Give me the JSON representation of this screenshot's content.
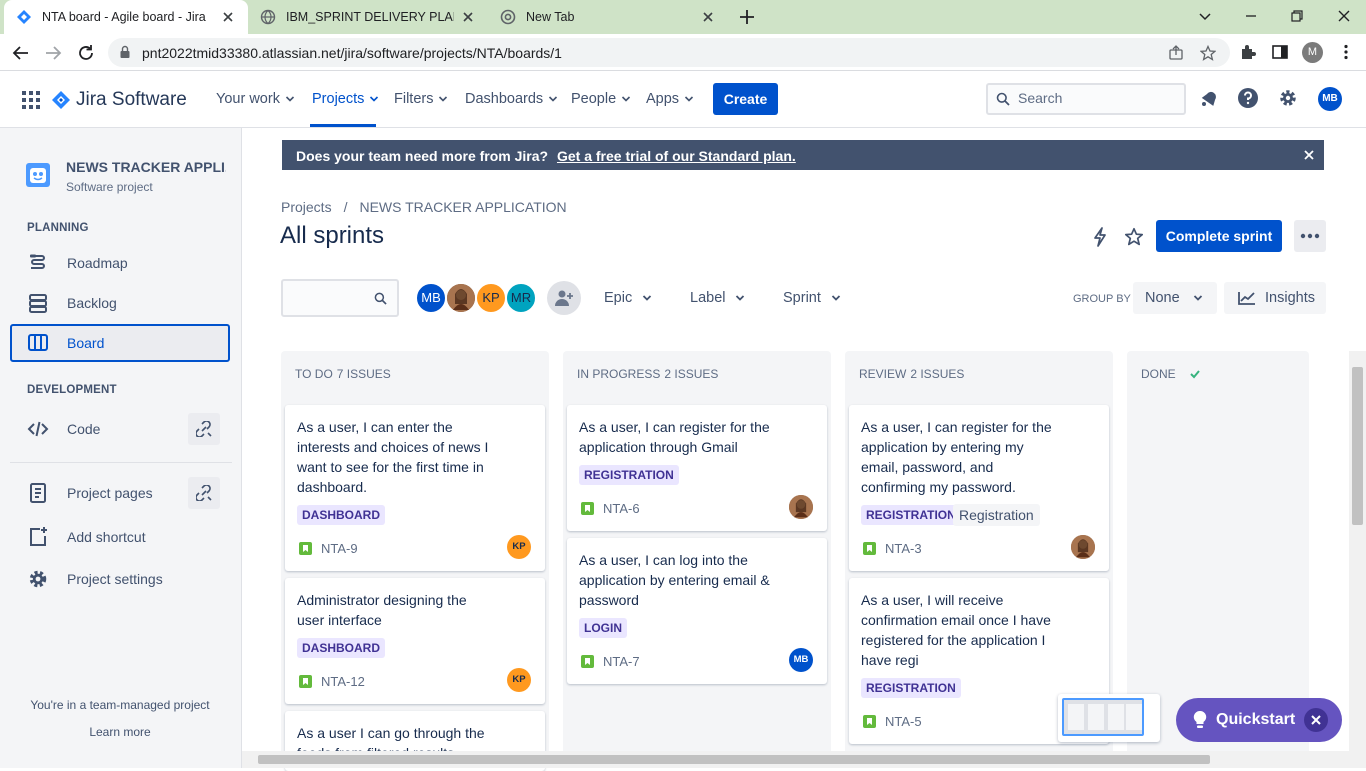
{
  "browser": {
    "tabs": [
      {
        "title": "NTA board - Agile board - Jira",
        "active": true
      },
      {
        "title": "IBM_SPRINT DELIVERY PLAN.doc",
        "active": false
      },
      {
        "title": "New Tab",
        "active": false
      }
    ],
    "url": "pnt2022tmid33380.atlassian.net/jira/software/projects/NTA/boards/1",
    "profile_initial": "M"
  },
  "topnav": {
    "product": "Jira Software",
    "items": [
      {
        "label": "Your work"
      },
      {
        "label": "Projects",
        "active": true
      },
      {
        "label": "Filters"
      },
      {
        "label": "Dashboards"
      },
      {
        "label": "People"
      },
      {
        "label": "Apps"
      }
    ],
    "create_label": "Create",
    "search_placeholder": "Search",
    "user_initials": "MB"
  },
  "sidebar": {
    "project_name": "NEWS TRACKER APPLI...",
    "project_type": "Software project",
    "planning_label": "PLANNING",
    "planning_items": [
      {
        "label": "Roadmap",
        "icon": "roadmap-icon"
      },
      {
        "label": "Backlog",
        "icon": "backlog-icon"
      },
      {
        "label": "Board",
        "icon": "board-icon",
        "active": true
      }
    ],
    "development_label": "DEVELOPMENT",
    "code_label": "Code",
    "bottom_items": [
      {
        "label": "Project pages",
        "icon": "project-pages-icon"
      },
      {
        "label": "Add shortcut",
        "icon": "add-shortcut-icon"
      },
      {
        "label": "Project settings",
        "icon": "gear-icon"
      }
    ],
    "team_note": "You're in a team-managed project",
    "learn_more": "Learn more"
  },
  "banner": {
    "text": "Does your team need more from Jira?",
    "link": "Get a free trial of our Standard plan."
  },
  "breadcrumb": [
    "Projects",
    "NEWS TRACKER APPLICATION"
  ],
  "page_title": "All sprints",
  "complete_sprint_label": "Complete sprint",
  "filters": {
    "avatars": [
      {
        "initials": "MB",
        "color": "#0052cc",
        "text_color": "#ffffff"
      },
      {
        "initials": "",
        "color": "#8a5a3c",
        "text_color": "#ffffff"
      },
      {
        "initials": "KP",
        "color": "#ff991f",
        "text_color": "#172b4d"
      },
      {
        "initials": "MR",
        "color": "#00a3bf",
        "text_color": "#172b4d"
      }
    ],
    "dropdowns": [
      "Epic",
      "Label",
      "Sprint"
    ],
    "group_by_label": "GROUP BY",
    "group_by_value": "None",
    "insights_label": "Insights"
  },
  "columns": [
    {
      "title": "TO DO",
      "count": "7 ISSUES",
      "cards": [
        {
          "summary": "As a user, I can enter the interests and choices of news I want to see for the first time in dashboard.",
          "epic": "DASHBOARD",
          "key": "NTA-9",
          "assignee": "KP"
        },
        {
          "summary": "Administrator designing the user interface",
          "epic": "DASHBOARD",
          "key": "NTA-12",
          "assignee": "KP"
        },
        {
          "summary": "As a user I can go through the feeds from filtered results",
          "epic": "",
          "key": "",
          "assignee": ""
        }
      ]
    },
    {
      "title": "IN PROGRESS",
      "count": "2 ISSUES",
      "cards": [
        {
          "summary": "As a user, I can register for the application through Gmail",
          "epic": "REGISTRATION",
          "key": "NTA-6",
          "assignee": "photo"
        },
        {
          "summary": "As a user, I can log into the application by entering email & password",
          "epic": "LOGIN",
          "key": "NTA-7",
          "assignee": "MB"
        }
      ]
    },
    {
      "title": "REVIEW",
      "count": "2 ISSUES",
      "cards": [
        {
          "summary": "As a user, I can register for the application by entering my email, password, and confirming my password.",
          "epic": "REGISTRATION",
          "label": "Registration",
          "key": "NTA-3",
          "assignee": "photo"
        },
        {
          "summary": "As a user, I will receive confirmation email once I have registered for the application I have regi",
          "epic": "REGISTRATION",
          "key": "NTA-5",
          "assignee": ""
        }
      ]
    },
    {
      "title": "DONE",
      "count": "",
      "cards": []
    }
  ],
  "quickstart_label": "Quickstart",
  "colors": {
    "brand_blue": "#0052cc",
    "story_green": "#63ba3c",
    "epic_purple_bg": "#eae6ff",
    "epic_purple_text": "#403294",
    "quickstart_purple": "#6554c0"
  }
}
